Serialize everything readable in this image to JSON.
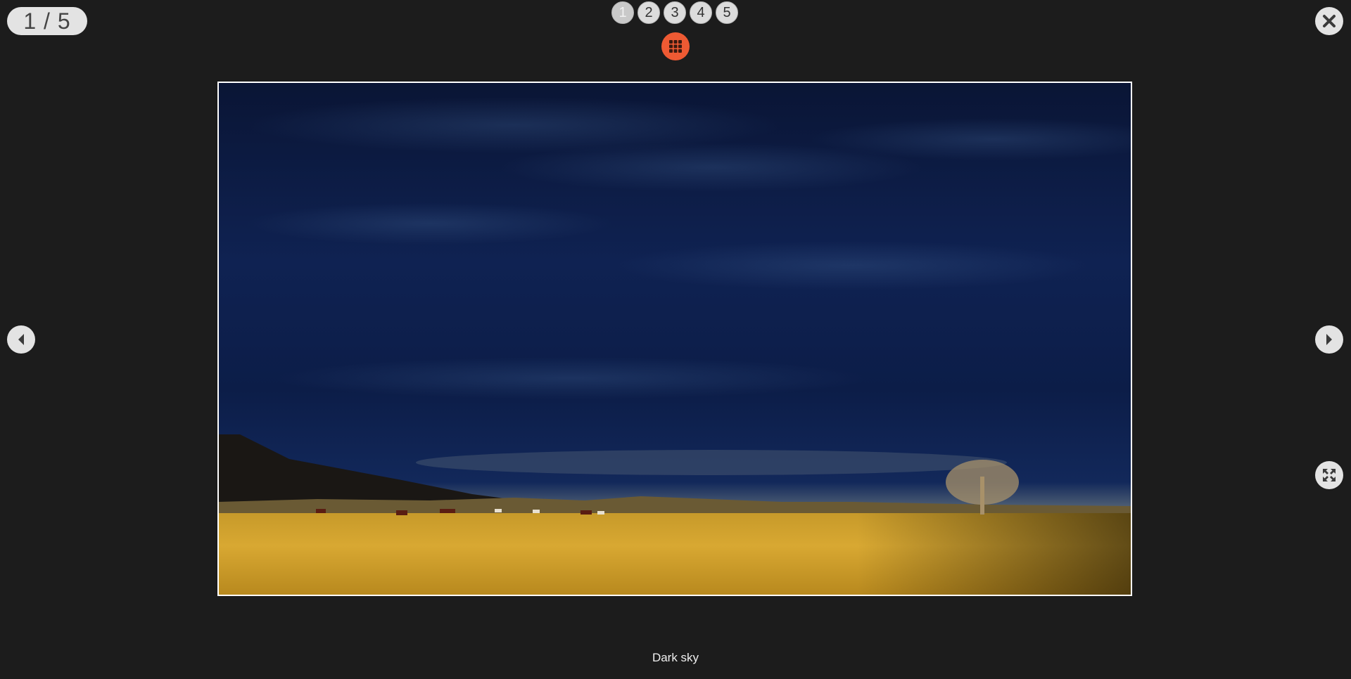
{
  "viewer": {
    "counter": "1 / 5",
    "pages": [
      "1",
      "2",
      "3",
      "4",
      "5"
    ],
    "active_page": "1",
    "caption": "Dark sky",
    "accent_color": "#ee5a33"
  },
  "icons": {
    "grid": "grid-icon",
    "close": "close-icon",
    "prev": "arrow-left-icon",
    "next": "arrow-right-icon",
    "fullscreen": "fullscreen-icon"
  }
}
